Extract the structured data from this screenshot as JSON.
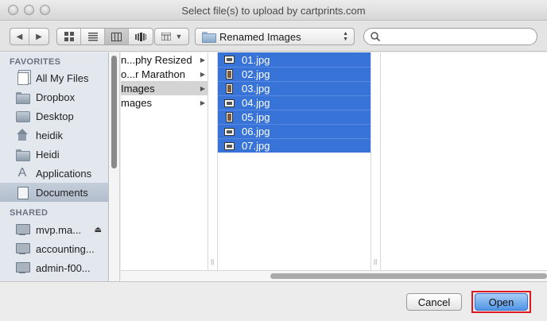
{
  "window": {
    "title": "Select file(s) to upload by cartprints.com"
  },
  "toolbar": {
    "path_label": "Renamed Images",
    "search_placeholder": ""
  },
  "sidebar": {
    "favorites_header": "FAVORITES",
    "favorites": [
      {
        "label": "All My Files",
        "icon": "all-files-icon"
      },
      {
        "label": "Dropbox",
        "icon": "folder-icon"
      },
      {
        "label": "Desktop",
        "icon": "desktop-icon"
      },
      {
        "label": "heidik",
        "icon": "home-icon"
      },
      {
        "label": "Heidi",
        "icon": "folder-icon"
      },
      {
        "label": "Applications",
        "icon": "applications-icon"
      },
      {
        "label": "Documents",
        "icon": "documents-icon",
        "selected": true
      }
    ],
    "shared_header": "SHARED",
    "shared": [
      {
        "label": "mvp.ma...",
        "icon": "monitor-icon",
        "eject": true
      },
      {
        "label": "accounting...",
        "icon": "monitor-icon"
      },
      {
        "label": "admin-f00...",
        "icon": "monitor-icon"
      }
    ]
  },
  "column1": {
    "items": [
      {
        "label": "n...phy Resized",
        "has_children": true
      },
      {
        "label": "o...r Marathon",
        "has_children": true
      },
      {
        "label": " Images",
        "has_children": true,
        "highlighted": true
      },
      {
        "label": "mages",
        "has_children": true
      }
    ]
  },
  "column2": {
    "files": [
      {
        "name": "01.jpg",
        "orientation": "landscape"
      },
      {
        "name": "02.jpg",
        "orientation": "portrait"
      },
      {
        "name": "03.jpg",
        "orientation": "portrait"
      },
      {
        "name": "04.jpg",
        "orientation": "landscape"
      },
      {
        "name": "05.jpg",
        "orientation": "portrait"
      },
      {
        "name": "06.jpg",
        "orientation": "landscape"
      },
      {
        "name": "07.jpg",
        "orientation": "landscape"
      }
    ]
  },
  "buttons": {
    "cancel": "Cancel",
    "open": "Open"
  },
  "colors": {
    "selection": "#3874d8",
    "highlight_border": "#e0181f",
    "sidebar_bg": "#e3e8ef"
  }
}
